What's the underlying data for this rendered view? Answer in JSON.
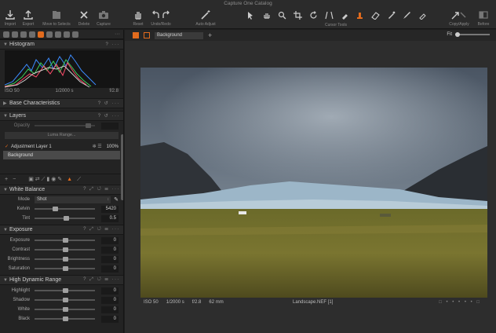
{
  "window": {
    "title": "Capture One Catalog"
  },
  "toolbar": {
    "import": "Import",
    "export": "Export",
    "move_to_selects": "Move to Selects",
    "delete": "Delete",
    "capture": "Capture",
    "reset": "Reset",
    "undo_redo": "Undo/Redo",
    "auto_adjust": "Auto Adjust",
    "cursor_tools": "Cursor Tools",
    "copy_apply": "Copy/Apply",
    "before": "Before"
  },
  "histogram": {
    "title": "Histogram",
    "iso": "ISO 50",
    "shutter": "1/2000 s",
    "aperture": "f/2.8"
  },
  "base_characteristics": {
    "title": "Base Characteristics"
  },
  "layers": {
    "title": "Layers",
    "opacity_label": "Opacity",
    "luma_range": "Luma Range...",
    "items": [
      {
        "name": "Adjustment Layer 1",
        "opacity": "100%"
      },
      {
        "name": "Background"
      }
    ]
  },
  "white_balance": {
    "title": "White Balance",
    "mode_label": "Mode",
    "mode_value": "Shot",
    "kelvin_label": "Kelvin",
    "kelvin_value": "5420",
    "tint_label": "Tint",
    "tint_value": "0.5"
  },
  "exposure": {
    "title": "Exposure",
    "rows": [
      {
        "label": "Exposure",
        "value": "0"
      },
      {
        "label": "Contrast",
        "value": "0"
      },
      {
        "label": "Brightness",
        "value": "0"
      },
      {
        "label": "Saturation",
        "value": "0"
      }
    ]
  },
  "hdr": {
    "title": "High Dynamic Range",
    "rows": [
      {
        "label": "Highlight",
        "value": "0"
      },
      {
        "label": "Shadow",
        "value": "0"
      },
      {
        "label": "White",
        "value": "0"
      },
      {
        "label": "Black",
        "value": "0"
      }
    ]
  },
  "viewer": {
    "layer_select": "Background",
    "fit_label": "Fit",
    "info_iso": "ISO 50",
    "info_shutter": "1/2000 s",
    "info_aperture": "f/2.8",
    "info_focal": "62 mm",
    "filename": "Landscape.NEF [1]"
  },
  "colors": {
    "accent": "#e26b1d",
    "panel_bg": "#232323",
    "viewer_bg": "#2d2d2d"
  }
}
